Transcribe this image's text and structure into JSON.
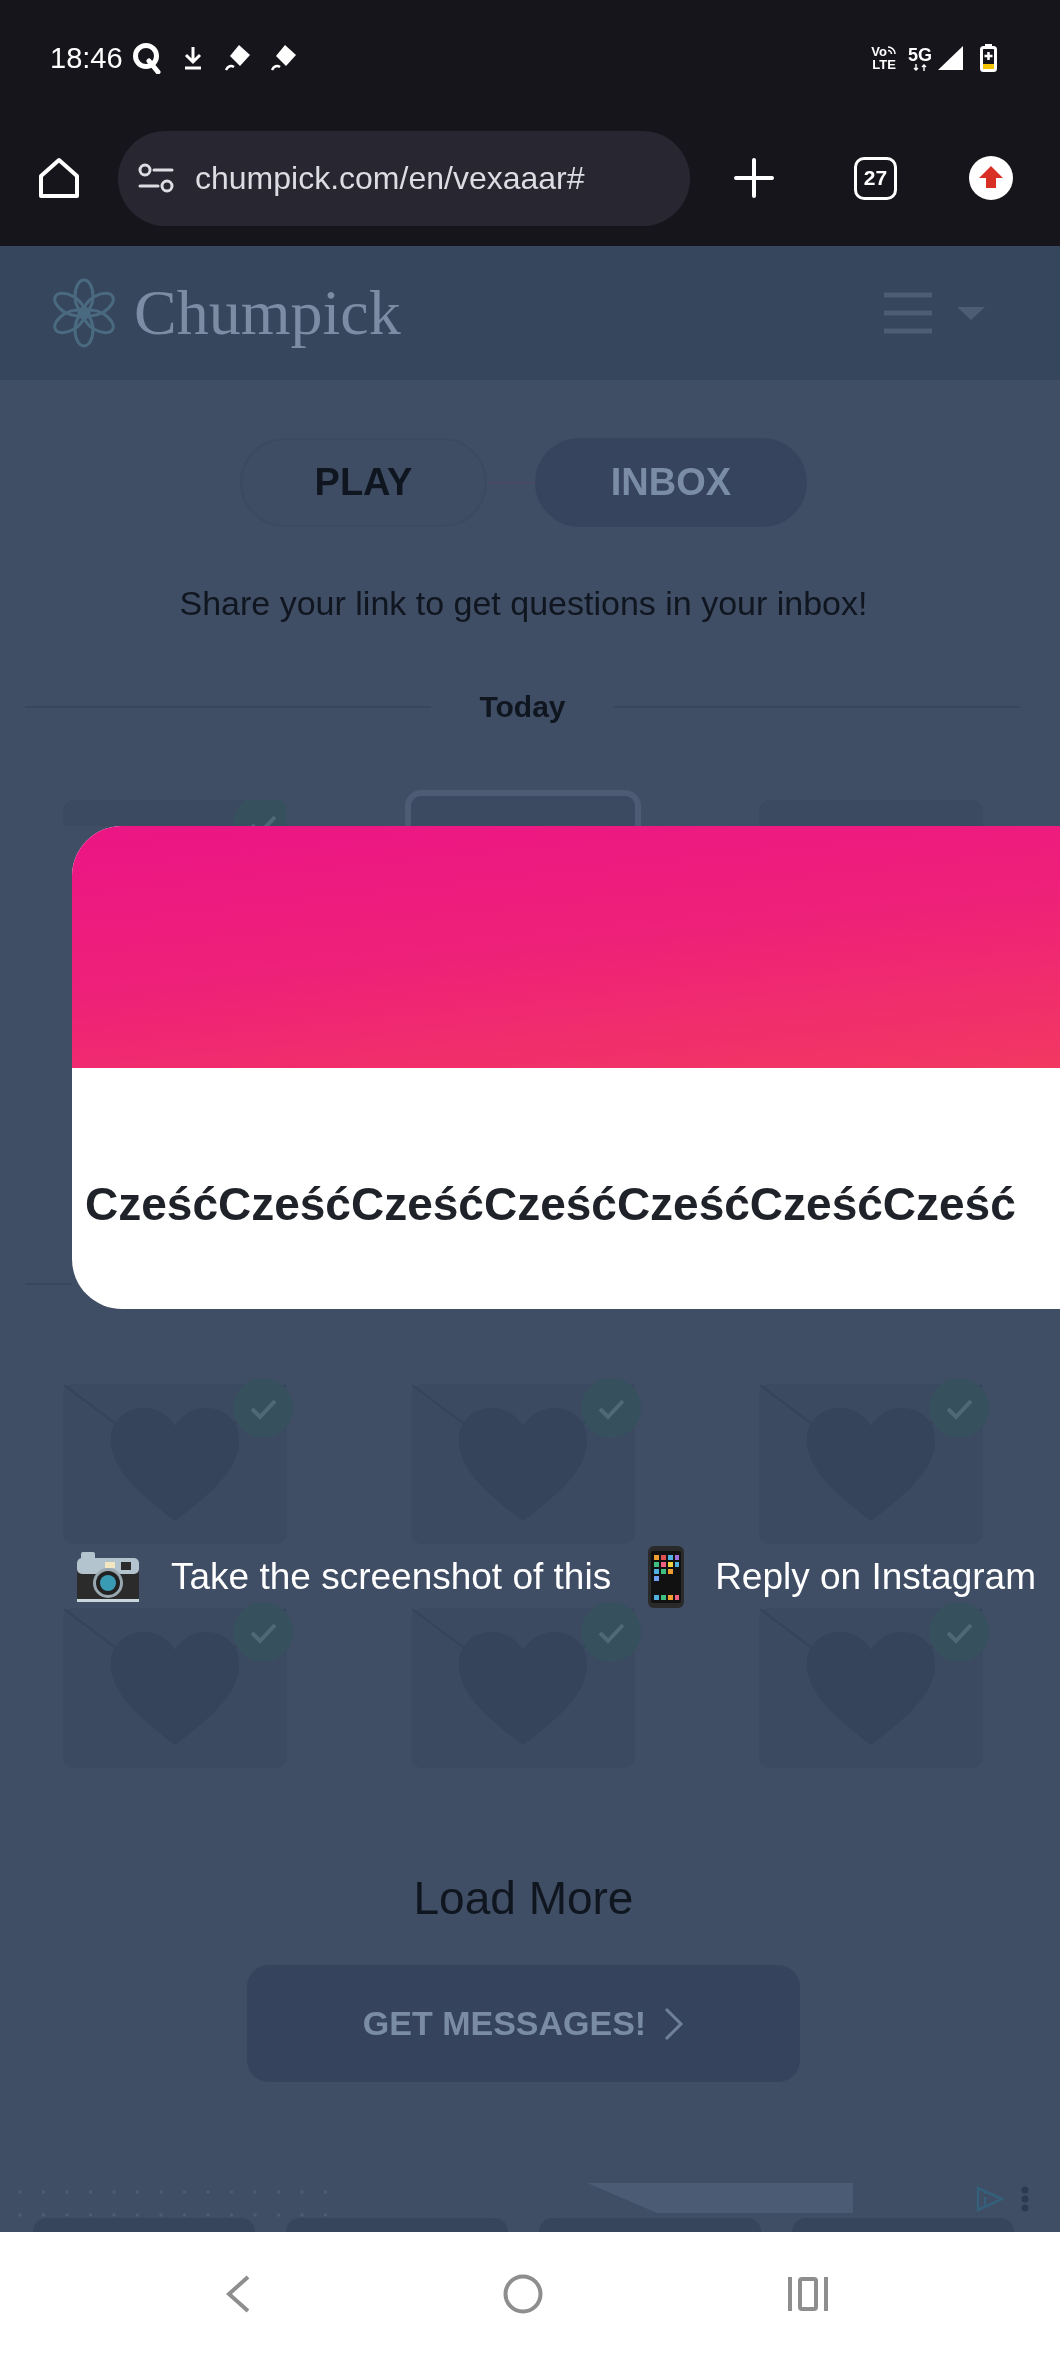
{
  "status_bar": {
    "time": "18:46",
    "volte": [
      "Vo",
      "LTE"
    ],
    "network": "5G"
  },
  "browser": {
    "url": "chumpick.com/en/vexaaar#",
    "tab_count": "27"
  },
  "header": {
    "logo": "Chumpick"
  },
  "tabs": [
    {
      "label": "PLAY",
      "selected": false
    },
    {
      "label": "INBOX",
      "selected": true
    }
  ],
  "hint": "Share your link to get questions in your inbox!",
  "inbox": {
    "label": "Today",
    "messages": [
      {
        "read": true,
        "selected": false
      },
      {
        "read": false,
        "selected": true
      },
      {
        "read": false,
        "selected": false
      },
      {
        "read": true,
        "selected": false
      },
      {
        "read": true,
        "selected": false
      },
      {
        "read": true,
        "selected": false
      },
      {
        "read": true,
        "selected": false
      },
      {
        "read": true,
        "selected": false
      },
      {
        "read": true,
        "selected": false
      }
    ]
  },
  "modal": {
    "message": "CześćCześćCześćCześćCześćCześćCześć",
    "actions": [
      {
        "kind": "camera",
        "label": "Take the screenshot of this"
      },
      {
        "kind": "phone",
        "label": "Reply on Instagram"
      }
    ]
  },
  "load_more": "Load More",
  "cta": "GET MESSAGES!"
}
